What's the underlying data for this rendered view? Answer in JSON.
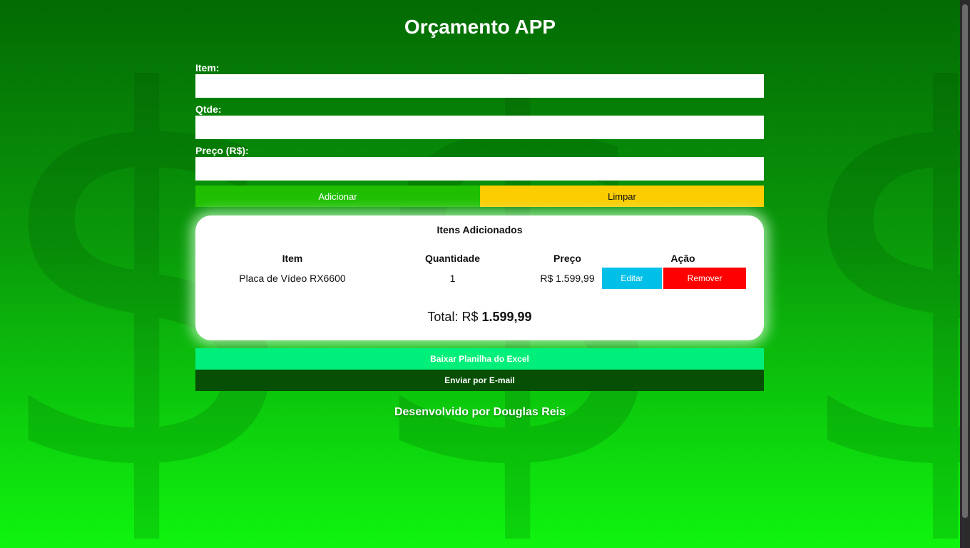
{
  "app": {
    "title": "Orçamento APP"
  },
  "background": {
    "symbol": "$"
  },
  "form": {
    "item_label": "Item:",
    "item_value": "",
    "qty_label": "Qtde:",
    "qty_value": "",
    "price_label": "Preço (R$):",
    "price_value": "",
    "add_button": "Adicionar",
    "clear_button": "Limpar"
  },
  "items_card": {
    "title": "Itens Adicionados",
    "columns": [
      "Item",
      "Quantidade",
      "Preço",
      "Ação"
    ],
    "rows": [
      {
        "item": "Placa de Vídeo RX6600",
        "quantity": "1",
        "price": "R$ 1.599,99",
        "edit_label": "Editar",
        "remove_label": "Remover"
      }
    ],
    "total_prefix": "Total: R$",
    "total_value": "1.599,99"
  },
  "actions": {
    "excel_button": "Baixar Planilha do Excel",
    "email_button": "Enviar por E-mail"
  },
  "footer": {
    "text": "Desenvolvido por Douglas Reis"
  },
  "colors": {
    "add": "#1fbf00",
    "clear": "#fbcd00",
    "edit": "#00c0e8",
    "remove": "#ff0000",
    "excel": "#00ee7a",
    "email": "#064f04"
  }
}
